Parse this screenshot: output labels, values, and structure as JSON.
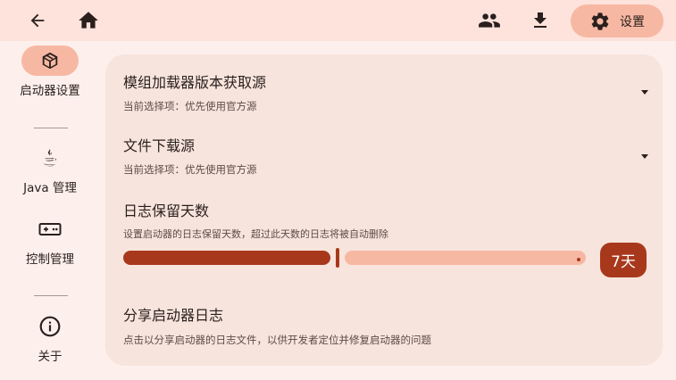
{
  "topbar": {
    "back": "arrow-back-icon",
    "home": "home-icon",
    "accounts": "accounts-icon",
    "download": "download-icon",
    "settings_label": "设置"
  },
  "sidebar": {
    "items": [
      {
        "label": "启动器设置",
        "icon": "cube-icon",
        "active": true
      },
      {
        "label": "Java 管理",
        "icon": "java-icon",
        "active": false
      },
      {
        "label": "控制管理",
        "icon": "gamepad-icon",
        "active": false
      },
      {
        "label": "关于",
        "icon": "info-icon",
        "active": false
      }
    ]
  },
  "settings": {
    "mod_loader_source": {
      "title": "模组加载器版本获取源",
      "subtitle": "当前选择项：优先使用官方源"
    },
    "file_download_source": {
      "title": "文件下载源",
      "subtitle": "当前选择项：优先使用官方源"
    },
    "log_retention": {
      "title": "日志保留天数",
      "subtitle": "设置启动器的日志保留天数，超过此天数的日志将被自动删除",
      "value_label": "7天",
      "fraction": 0.46
    },
    "share_logs": {
      "title": "分享启动器日志",
      "subtitle": "点击以分享启动器的日志文件，以供开发者定位并修复启动器的问题"
    }
  },
  "colors": {
    "accent": "#a8381c",
    "accent_light": "#f7b8a3",
    "background": "#fdf0ec",
    "card": "#f7e4dd",
    "topbar": "#fde3db"
  }
}
